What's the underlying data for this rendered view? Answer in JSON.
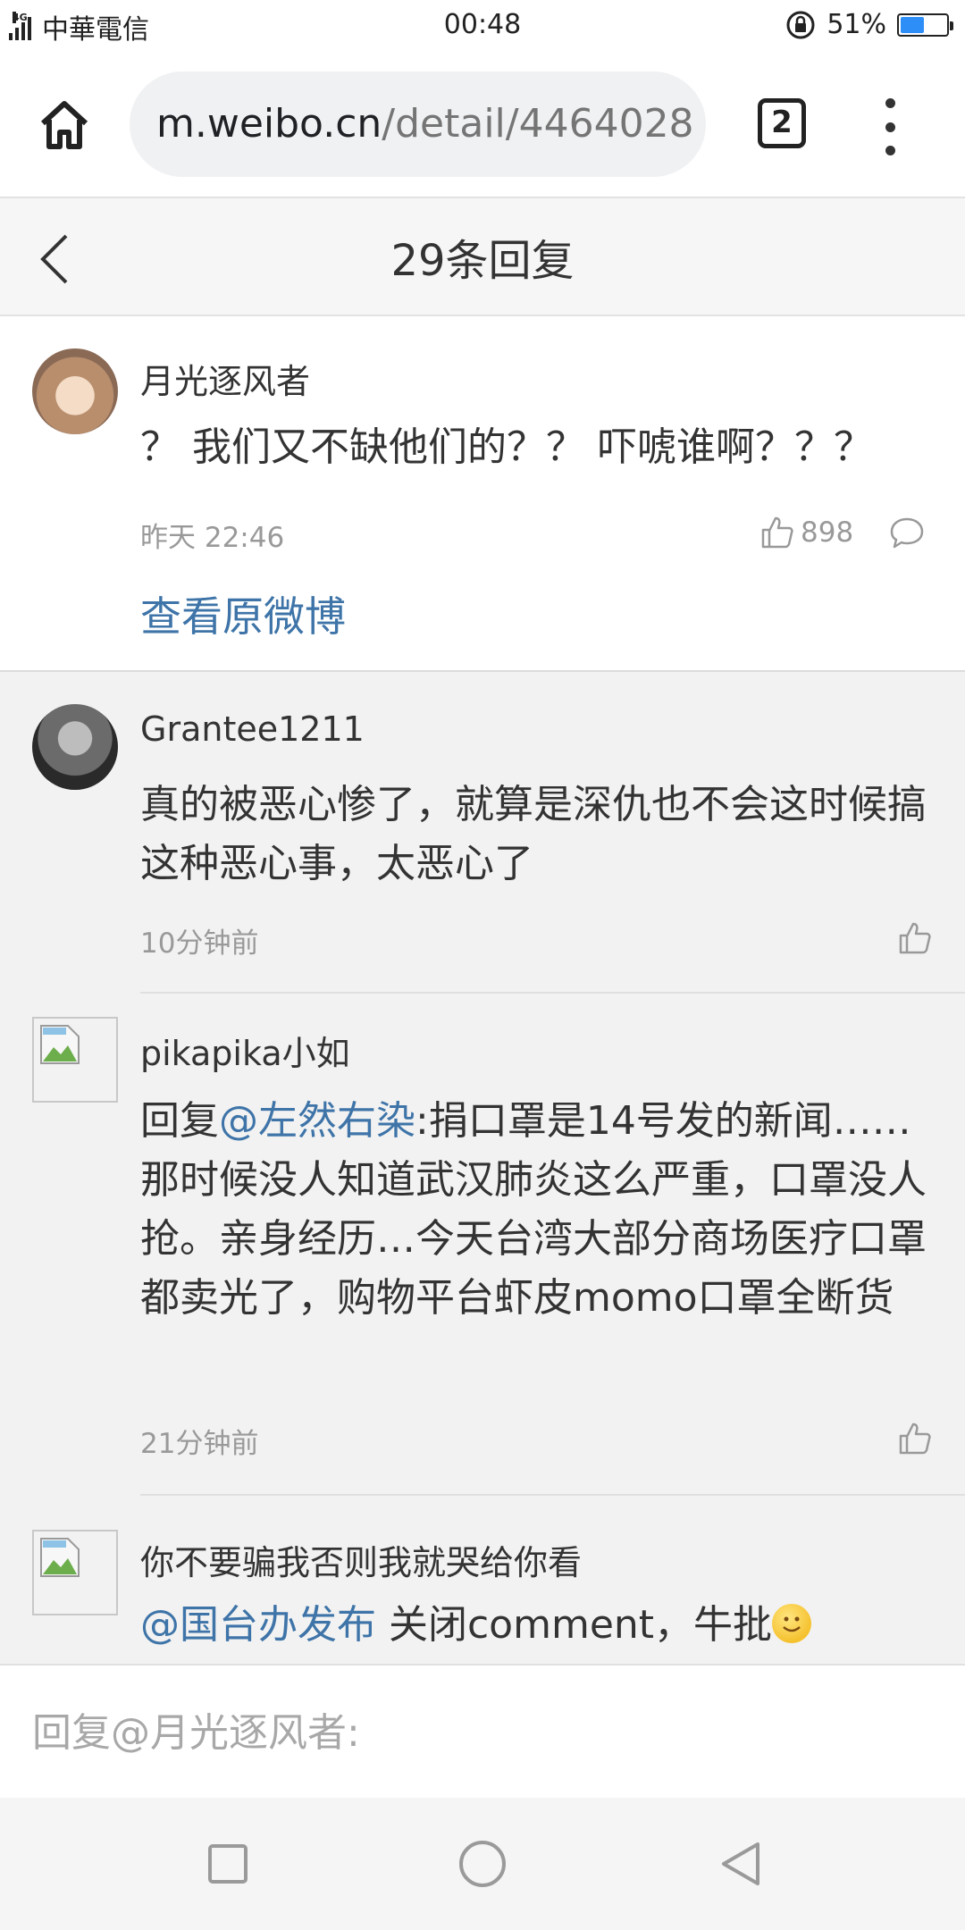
{
  "status_bar": {
    "network": "4G",
    "carrier": "中華電信",
    "time": "00:48",
    "battery_text": "51%",
    "battery_level": 0.51,
    "icons": [
      "signal-icon",
      "lock-rotation-icon",
      "battery-icon"
    ]
  },
  "browser": {
    "url_domain": "m.weibo.cn",
    "url_path": "/detail/4464028",
    "tab_count": "2",
    "icons": [
      "home-icon",
      "overflow-menu-icon"
    ]
  },
  "header": {
    "title": "29条回复",
    "back_icon": "chevron-left-icon"
  },
  "main_post": {
    "username": "月光逐风者",
    "text": "？ 我们又不缺他们的？？ 吓唬谁啊？？？",
    "time": "昨天 22:46",
    "likes": "898",
    "view_original": "查看原微博"
  },
  "replies": [
    {
      "username": "Grantee1211",
      "text": "真的被恶心惨了，就算是深仇也不会这时候搞这种恶心事，太恶心了",
      "time": "10分钟前"
    },
    {
      "username": "pikapika小如",
      "prefix": "回复",
      "mention": "@左然右染",
      "text": ":捐口罩是14号发的新闻……那时候没人知道武汉肺炎这么严重，口罩没人抢。亲身经历…今天台湾大部分商场医疗口罩都卖光了，购物平台虾皮momo口罩全断货",
      "time": "21分钟前"
    },
    {
      "username": "你不要骗我否则我就哭给你看",
      "mention": "@国台办发布",
      "text": " 关闭comment，牛批",
      "emoji": "smile-emoji"
    }
  ],
  "reply_input": {
    "placeholder": "回复@月光逐风者:"
  },
  "nav": {
    "icons": [
      "recents-square-icon",
      "home-circle-icon",
      "back-triangle-icon"
    ]
  }
}
